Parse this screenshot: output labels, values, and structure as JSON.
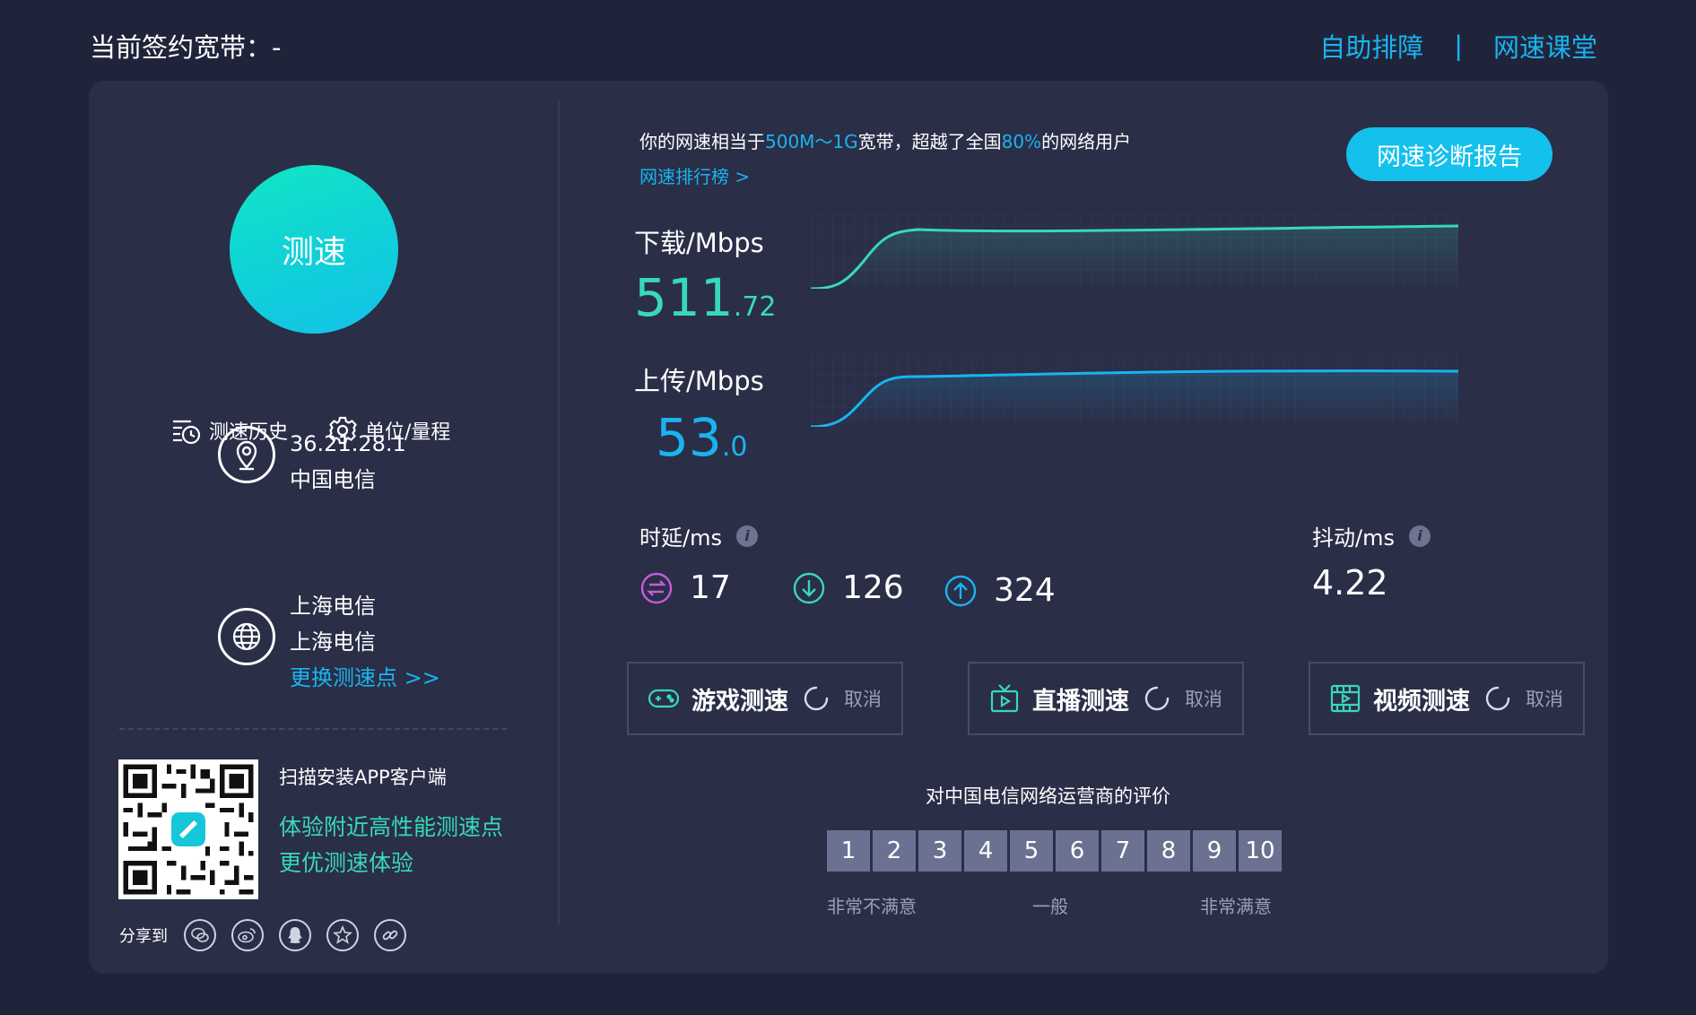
{
  "header": {
    "title": "当前签约宽带：-",
    "links": [
      "自助排障",
      "网速课堂"
    ],
    "separator": "|"
  },
  "left": {
    "start_button": "测速",
    "tools": [
      {
        "label": "测速历史",
        "icon": "history-icon"
      },
      {
        "label": "单位/量程",
        "icon": "gear-icon"
      }
    ],
    "client": {
      "ip": "36.21.28.1",
      "isp": "中国电信",
      "icon": "location-pin-icon"
    },
    "server": {
      "line1": "上海电信",
      "line2": "上海电信",
      "change_link": "更换测速点 >>",
      "icon": "globe-icon"
    },
    "qr": {
      "line1": "扫描安装APP客户端",
      "line2": "体验附近高性能测速点",
      "line3": "更优测速体验"
    },
    "share": {
      "label": "分享到",
      "icons": [
        "wechat-icon",
        "weibo-icon",
        "qq-icon",
        "qzone-icon",
        "link-icon"
      ]
    }
  },
  "summary": {
    "prefix": "你的网速相当于",
    "tier": "500M～1G",
    "middle": "宽带，超越了全国",
    "percent": "80%",
    "suffix": "的网络用户",
    "ranking_link": "网速排行榜 >",
    "report_button": "网速诊断报告"
  },
  "download": {
    "label": "下载/Mbps",
    "int": "511",
    "dec": ".72",
    "color": "#38d9b6"
  },
  "upload": {
    "label": "上传/Mbps",
    "int": "53",
    "dec": ".0",
    "color": "#19b4f0"
  },
  "latency": {
    "label": "时延/ms",
    "info": "i",
    "items": [
      {
        "value": "17",
        "icon": "exchange-icon",
        "color": "#c45be0"
      },
      {
        "value": "126",
        "icon": "arrow-down-icon",
        "color": "#38d9b6"
      },
      {
        "value": "324",
        "icon": "arrow-up-icon",
        "color": "#19b4f0"
      }
    ]
  },
  "jitter": {
    "label": "抖动/ms",
    "info": "i",
    "value": "4.22"
  },
  "tests": [
    {
      "label": "游戏测速",
      "cancel": "取消",
      "icon": "gamepad-icon"
    },
    {
      "label": "直播测速",
      "cancel": "取消",
      "icon": "tv-icon"
    },
    {
      "label": "视频测速",
      "cancel": "取消",
      "icon": "film-icon"
    }
  ],
  "rating": {
    "title": "对中国电信网络运营商的评价",
    "scores": [
      "1",
      "2",
      "3",
      "4",
      "5",
      "6",
      "7",
      "8",
      "9",
      "10"
    ],
    "low": "非常不满意",
    "mid": "一般",
    "high": "非常满意"
  }
}
